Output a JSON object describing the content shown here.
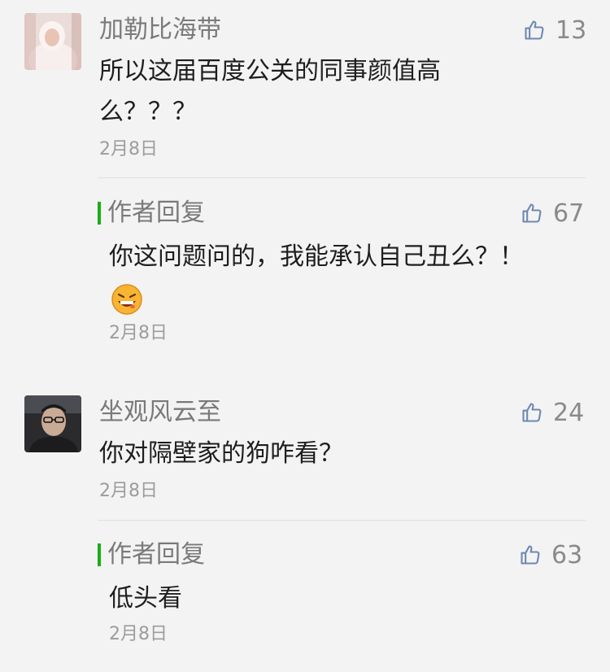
{
  "comments": [
    {
      "nickname": "加勒比海带",
      "content_line1": "所以这届百度公关的同事颜值高",
      "content_line2": "么？？？",
      "date": "2月8日",
      "likes": "13",
      "reply": {
        "label": "作者回复",
        "likes": "67",
        "content": "你这问题问的，我能承认自己丑么？！",
        "emoji": "grinning-emoji-icon",
        "date": "2月8日"
      }
    },
    {
      "nickname": "坐观风云至",
      "content": "你对隔壁家的狗咋看？",
      "date": "2月8日",
      "likes": "24",
      "reply": {
        "label": "作者回复",
        "likes": "63",
        "content": "低头看",
        "date": "2月8日"
      }
    }
  ],
  "colors": {
    "background": "#f3f3f3",
    "nickname": "#7a7a7a",
    "content": "#1e1e1e",
    "date": "#9c9c9c",
    "reply_bar": "#1aad19"
  }
}
